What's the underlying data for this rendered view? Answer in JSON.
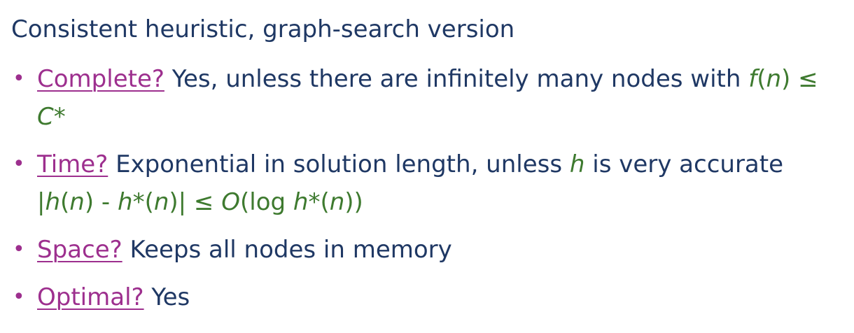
{
  "heading": "Consistent heuristic, graph-search version",
  "bullet_char": "•",
  "items": [
    {
      "label": "Complete?",
      "text_a": " Yes, unless there are infinitely many nodes with ",
      "f": "f",
      "paren_open": "(",
      "n": "n",
      "paren_close": ")",
      "le": " ≤",
      "cstar": "C*"
    },
    {
      "label": "Time?",
      "text_a": " Exponential in solution length, unless ",
      "h": "h",
      "text_b": " is very accurate",
      "bar_open": "|",
      "h2": "h",
      "p1": "(",
      "n1": "n",
      "p2": ") - ",
      "hstar": "h*",
      "p3": "(",
      "n2": "n",
      "p4": ")",
      "bar_close": "| ≤ ",
      "bigO": "O",
      "p5": "(log ",
      "hstar2": "h*",
      "p6": "(",
      "n3": "n",
      "p7": "))"
    },
    {
      "label": "Space?",
      "text_a": " Keeps all nodes in memory"
    },
    {
      "label": "Optimal?",
      "text_a": " Yes"
    }
  ],
  "colors": {
    "text": "#1f3864",
    "accent": "#9d2f8e",
    "math": "#3e7a2f"
  }
}
